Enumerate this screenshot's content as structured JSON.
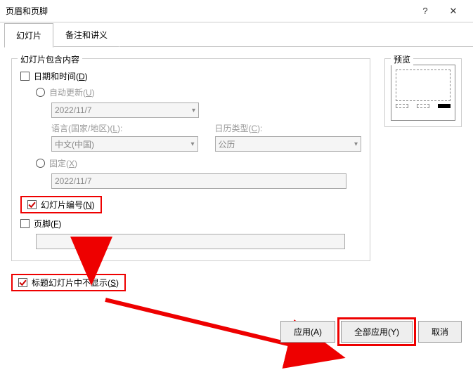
{
  "title": "页眉和页脚",
  "helpIcon": "?",
  "closeIcon": "✕",
  "tabs": {
    "slide": "幻灯片",
    "notes": "备注和讲义"
  },
  "group": {
    "legend": "幻灯片包含内容",
    "dateTime": "日期和时间(D)",
    "autoUpdate": "自动更新(U)",
    "dateValue": "2022/11/7",
    "langLabel": "语言(国家/地区)(L):",
    "langValue": "中文(中国)",
    "calLabel": "日历类型(C):",
    "calValue": "公历",
    "fixed": "固定(X)",
    "fixedValue": "2022/11/7",
    "slideNum": "幻灯片编号(N)",
    "footer": "页脚(F)",
    "noTitle": "标题幻灯片中不显示(S)"
  },
  "preview": {
    "legend": "预览"
  },
  "buttons": {
    "apply": "应用(A)",
    "applyAll": "全部应用(Y)",
    "cancel": "取消"
  }
}
